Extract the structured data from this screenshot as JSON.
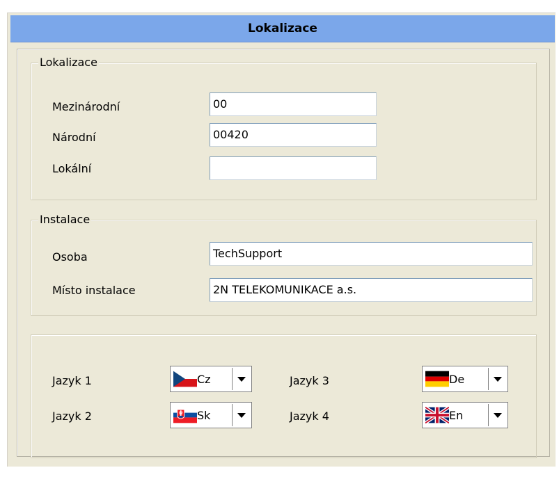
{
  "title": "Lokalizace",
  "localization": {
    "legend": "Lokalizace",
    "international_label": "Mezinárodní",
    "international_value": "00",
    "national_label": "Národní",
    "national_value": "00420",
    "local_label": "Lokální",
    "local_value": ""
  },
  "installation": {
    "legend": "Instalace",
    "person_label": "Osoba",
    "person_value": "TechSupport",
    "place_label": "Místo instalace",
    "place_value": "2N TELEKOMUNIKACE a.s."
  },
  "languages": [
    {
      "label": "Jazyk 1",
      "value": "Cz",
      "flag": "czech-flag-icon"
    },
    {
      "label": "Jazyk 2",
      "value": "Sk",
      "flag": "slovak-flag-icon"
    },
    {
      "label": "Jazyk 3",
      "value": "De",
      "flag": "german-flag-icon"
    },
    {
      "label": "Jazyk 4",
      "value": "En",
      "flag": "uk-flag-icon"
    }
  ]
}
